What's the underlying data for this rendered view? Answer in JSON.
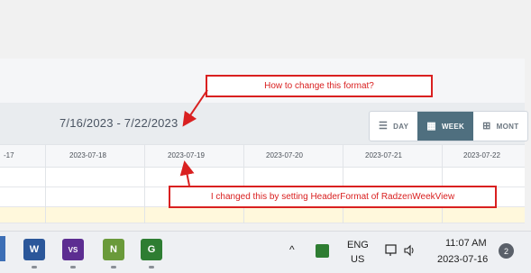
{
  "scheduler": {
    "date_range": "7/16/2023 - 7/22/2023",
    "views": [
      {
        "label": "DAY",
        "icon": "list-icon",
        "active": false
      },
      {
        "label": "WEEK",
        "icon": "calendar-week-icon",
        "active": true
      },
      {
        "label": "MONT",
        "icon": "calendar-grid-icon",
        "active": false
      }
    ],
    "columns": [
      "-17",
      "2023-07-18",
      "2023-07-19",
      "2023-07-20",
      "2023-07-21",
      "2023-07-22"
    ]
  },
  "annotations": {
    "top_note": "How to change this format?",
    "bottom_note": "I changed this by setting HeaderFormat of RadzenWeekView",
    "color": "#d92020"
  },
  "taskbar": {
    "apps": [
      {
        "name": "word",
        "letter": "W",
        "color": "#2b579a"
      },
      {
        "name": "visual-studio",
        "letter": "VS",
        "color": "#5c2d91"
      },
      {
        "name": "notepad-plus",
        "letter": "N",
        "color": "#6a9a3a"
      },
      {
        "name": "green-app",
        "letter": "G",
        "color": "#2e7d32"
      }
    ],
    "tray": {
      "chevron": "^",
      "lang_top": "ENG",
      "lang_bottom": "US",
      "time": "11:07 AM",
      "date": "2023-07-16",
      "notifications": "2"
    }
  }
}
